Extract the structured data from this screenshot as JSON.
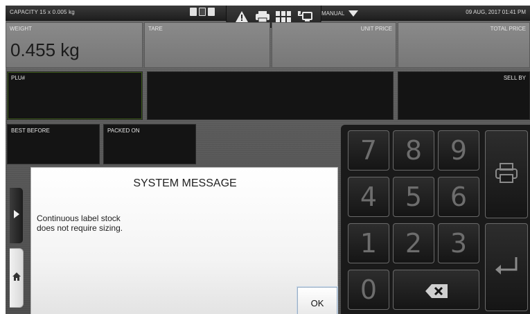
{
  "statusbar": {
    "capacity": "CAPACITY   15 x 0.005 kg",
    "mode": "MANUAL",
    "datetime": "09 AUG, 2017 01:41 PM"
  },
  "fields": {
    "weight_label": "WEIGHT",
    "weight_value": "0.455 kg",
    "tare_label": "TARE",
    "unit_price_label": "UNIT PRICE",
    "total_price_label": "TOTAL PRICE",
    "plu_label": "PLU#",
    "sell_by_label": "SELL BY",
    "best_before_label": "BEST BEFORE",
    "packed_on_label": "PACKED ON"
  },
  "keypad": {
    "keys": [
      "7",
      "8",
      "9",
      "4",
      "5",
      "6",
      "1",
      "2",
      "3",
      "0"
    ]
  },
  "dialog": {
    "title": "SYSTEM MESSAGE",
    "message_line1": "Continuous label stock",
    "message_line2": "does not require sizing.",
    "ok_label": "OK"
  },
  "icons": {
    "warning": "warning-icon",
    "printer": "printer-icon",
    "grid": "grid-icon",
    "network": "network-icon",
    "backspace": "backspace-icon",
    "enter": "enter-icon",
    "home": "home-icon",
    "expand": "chevron-right-icon"
  }
}
